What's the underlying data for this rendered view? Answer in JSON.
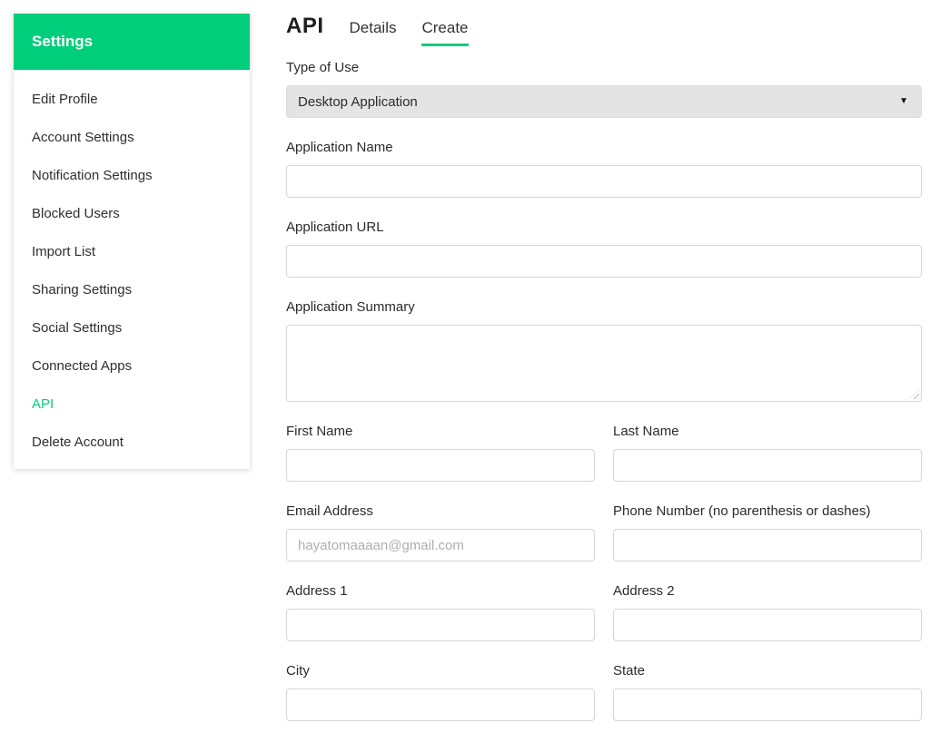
{
  "brand": {
    "green": "#00ce7b"
  },
  "sidebar": {
    "title": "Settings",
    "items": [
      {
        "label": "Edit Profile",
        "active": false
      },
      {
        "label": "Account Settings",
        "active": false
      },
      {
        "label": "Notification Settings",
        "active": false
      },
      {
        "label": "Blocked Users",
        "active": false
      },
      {
        "label": "Import List",
        "active": false
      },
      {
        "label": "Sharing Settings",
        "active": false
      },
      {
        "label": "Social Settings",
        "active": false
      },
      {
        "label": "Connected Apps",
        "active": false
      },
      {
        "label": "API",
        "active": true
      },
      {
        "label": "Delete Account",
        "active": false
      }
    ]
  },
  "header": {
    "title": "API",
    "tabs": [
      {
        "label": "Details",
        "active": false
      },
      {
        "label": "Create",
        "active": true
      }
    ]
  },
  "icons": {
    "dropdown_caret": "▼"
  },
  "form": {
    "type_of_use": {
      "label": "Type of Use",
      "value": "Desktop Application"
    },
    "application_name": {
      "label": "Application Name",
      "value": ""
    },
    "application_url": {
      "label": "Application URL",
      "value": ""
    },
    "application_summary": {
      "label": "Application Summary",
      "value": ""
    },
    "first_name": {
      "label": "First Name",
      "value": ""
    },
    "last_name": {
      "label": "Last Name",
      "value": ""
    },
    "email": {
      "label": "Email Address",
      "value": "",
      "placeholder": "hayatomaaaan@gmail.com"
    },
    "phone": {
      "label": "Phone Number (no parenthesis or dashes)",
      "value": ""
    },
    "address1": {
      "label": "Address 1",
      "value": ""
    },
    "address2": {
      "label": "Address 2",
      "value": ""
    },
    "city": {
      "label": "City",
      "value": ""
    },
    "state": {
      "label": "State",
      "value": ""
    }
  }
}
